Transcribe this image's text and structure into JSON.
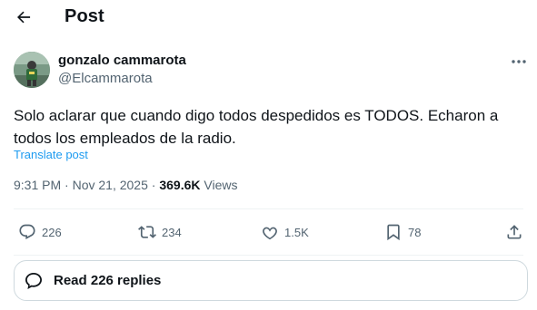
{
  "header": {
    "title": "Post"
  },
  "post": {
    "author_name": "gonzalo cammarota",
    "author_handle": "@Elcammarota",
    "text": "Solo aclarar que cuando digo todos despedidos es TODOS. Echaron a todos los empleados de la radio.",
    "translate_label": "Translate post",
    "time": "9:31 PM",
    "separator": "·",
    "date": "Nov 21, 2025",
    "views_count": "369.6K",
    "views_label": "Views"
  },
  "actions": {
    "replies": "226",
    "reposts": "234",
    "likes": "1.5K",
    "bookmarks": "78"
  },
  "read_replies": {
    "label": "Read 226 replies"
  },
  "colors": {
    "text": "#0f1419",
    "secondary": "#536471",
    "link": "#1d9bf0",
    "border": "#cfd9de",
    "divider": "#eff3f4"
  },
  "icons": {
    "back": "arrow-left-icon",
    "more": "more-horizontal-icon",
    "reply": "speech-bubble-icon",
    "repost": "repost-arrows-icon",
    "like": "heart-icon",
    "bookmark": "bookmark-icon",
    "share": "share-upload-icon",
    "read_replies": "chat-bubbles-icon"
  }
}
